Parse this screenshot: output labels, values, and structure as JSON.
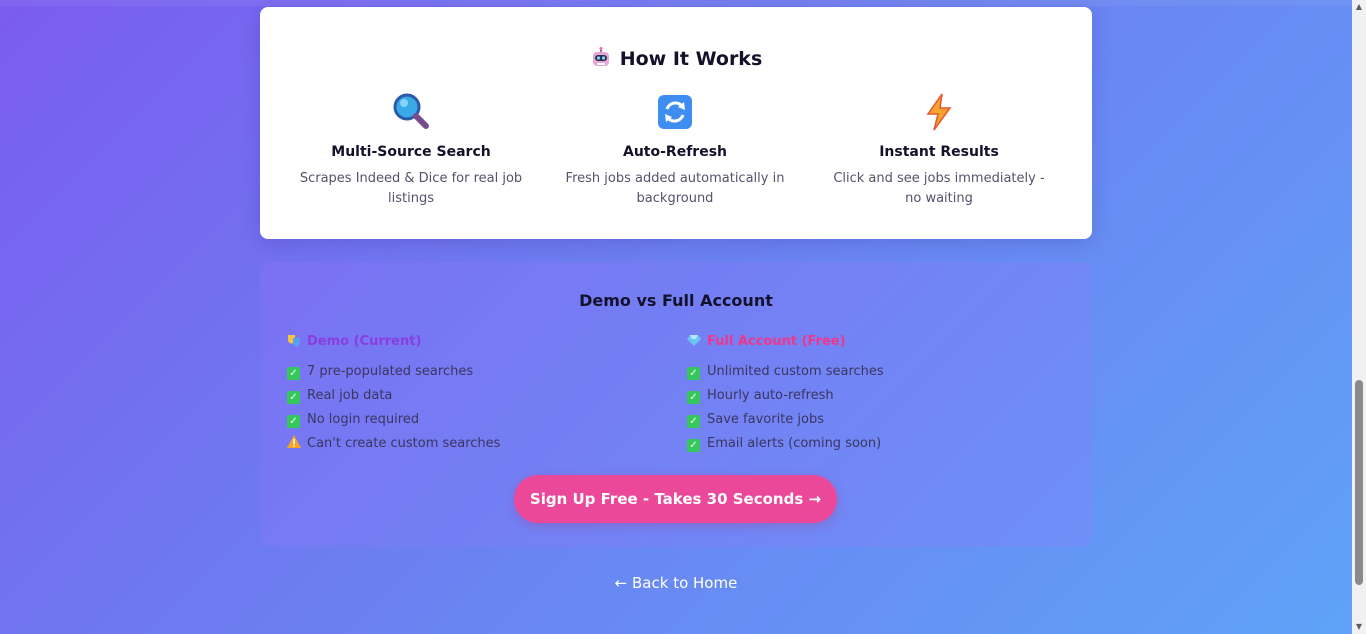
{
  "how_it_works": {
    "title": "How It Works",
    "features": [
      {
        "icon": "magnifier-icon",
        "name": "Multi-Source Search",
        "description": "Scrapes Indeed & Dice for real job listings"
      },
      {
        "icon": "refresh-icon",
        "name": "Auto-Refresh",
        "description": "Fresh jobs added automatically in background"
      },
      {
        "icon": "lightning-icon",
        "name": "Instant Results",
        "description": "Click and see jobs immediately - no waiting"
      }
    ]
  },
  "comparison": {
    "title": "Demo vs Full Account",
    "demo": {
      "heading": "Demo (Current)",
      "items": [
        {
          "text": "7 pre-populated searches",
          "status": "check"
        },
        {
          "text": "Real job data",
          "status": "check"
        },
        {
          "text": "No login required",
          "status": "check"
        },
        {
          "text": "Can't create custom searches",
          "status": "warning"
        }
      ]
    },
    "full": {
      "heading": "Full Account (Free)",
      "items": [
        {
          "text": "Unlimited custom searches",
          "status": "check"
        },
        {
          "text": "Hourly auto-refresh",
          "status": "check"
        },
        {
          "text": "Save favorite jobs",
          "status": "check"
        },
        {
          "text": "Email alerts (coming soon)",
          "status": "check"
        }
      ]
    }
  },
  "cta": {
    "signup_label": "Sign Up Free - Takes 30 Seconds →"
  },
  "nav": {
    "back_label": "← Back to Home"
  },
  "colors": {
    "accent_pink": "#ec4899",
    "demo_purple": "#8a3ee0",
    "full_pink": "#f0368c",
    "check_green": "#34c759"
  }
}
